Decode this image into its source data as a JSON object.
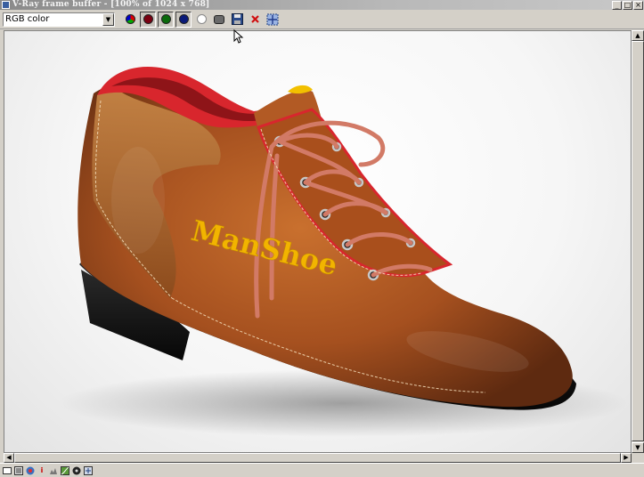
{
  "window": {
    "title": "V-Ray frame buffer - [100% of 1024 x 768]"
  },
  "toolbar": {
    "channel": {
      "selected": "RGB color"
    },
    "buttons": [
      {
        "name": "rgb-channel",
        "icon": "rgb-dot-icon"
      },
      {
        "name": "red-channel",
        "icon": "red-dot-icon"
      },
      {
        "name": "green-channel",
        "icon": "green-dot-icon"
      },
      {
        "name": "blue-channel",
        "icon": "blue-dot-icon"
      },
      {
        "name": "alpha-channel",
        "icon": "white-dot-icon"
      },
      {
        "name": "monochrome",
        "icon": "mono-icon"
      },
      {
        "name": "save-image",
        "icon": "floppy-disk-icon"
      },
      {
        "name": "clear-image",
        "icon": "red-x-icon"
      },
      {
        "name": "region-render",
        "icon": "region-icon"
      }
    ]
  },
  "render": {
    "logo_text": "ManShoe",
    "colors": {
      "leather": "#a8541f",
      "lining": "#d8262d",
      "logo": "#f2b400",
      "sole": "#151515",
      "lace": "#d27a66"
    }
  },
  "statusbar": {
    "icons": [
      "display-icon",
      "history-icon",
      "color-icon",
      "info-icon",
      "levels-icon",
      "curve-icon",
      "lens-icon",
      "settings-icon"
    ]
  }
}
